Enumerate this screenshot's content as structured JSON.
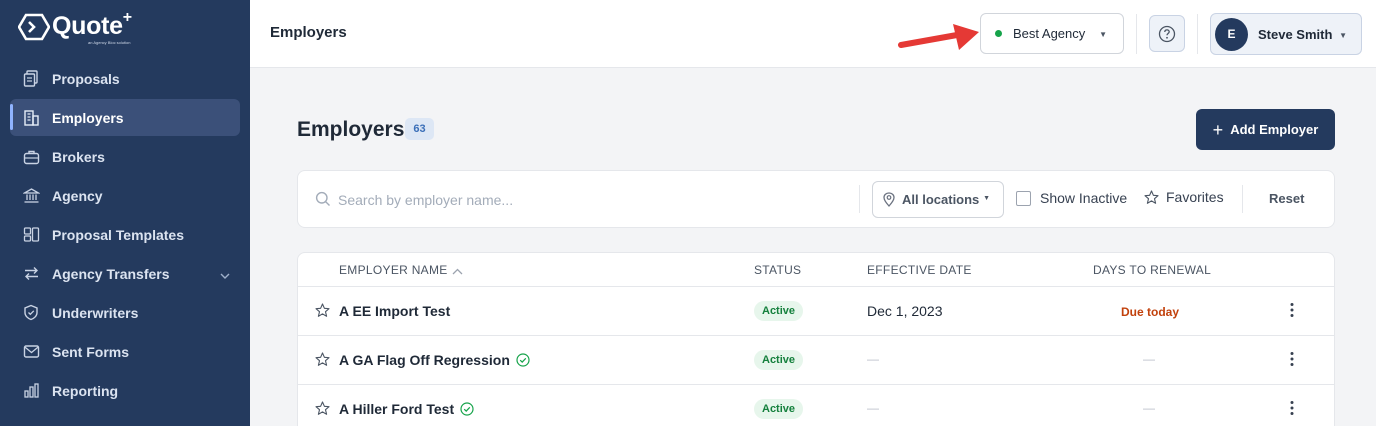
{
  "app": {
    "brand": "Quote",
    "brand_plus": "+",
    "brand_tagline": "an Agency Bloc solution"
  },
  "sidebar": {
    "items": [
      {
        "label": "Proposals",
        "icon": "document-icon"
      },
      {
        "label": "Employers",
        "icon": "building-icon",
        "active": true
      },
      {
        "label": "Brokers",
        "icon": "briefcase-icon"
      },
      {
        "label": "Agency",
        "icon": "bank-icon"
      },
      {
        "label": "Proposal Templates",
        "icon": "template-icon"
      },
      {
        "label": "Agency Transfers",
        "icon": "transfer-icon",
        "expandable": true
      },
      {
        "label": "Underwriters",
        "icon": "shield-icon"
      },
      {
        "label": "Sent Forms",
        "icon": "mail-icon"
      },
      {
        "label": "Reporting",
        "icon": "bar-chart-icon"
      }
    ]
  },
  "header": {
    "title": "Employers",
    "agency": {
      "label": "Best Agency",
      "status_color": "#16a34a"
    },
    "user": {
      "initial": "E",
      "name": "Steve Smith"
    }
  },
  "main": {
    "title": "Employers",
    "count": "63",
    "add_button_label": "Add Employer",
    "filters": {
      "search_placeholder": "Search by employer name...",
      "location_label": "All locations",
      "show_inactive_label": "Show Inactive",
      "favorites_label": "Favorites",
      "reset_label": "Reset"
    },
    "table": {
      "columns": [
        "EMPLOYER NAME",
        "STATUS",
        "EFFECTIVE DATE",
        "DAYS TO RENEWAL"
      ],
      "rows": [
        {
          "name": "A EE Import Test",
          "verified": false,
          "status": "Active",
          "effective_date": "Dec 1, 2023",
          "renewal": "Due today"
        },
        {
          "name": "A GA Flag Off Regression",
          "verified": true,
          "status": "Active",
          "effective_date": "—",
          "renewal": "—"
        },
        {
          "name": "A Hiller Ford Test",
          "verified": true,
          "status": "Active",
          "effective_date": "—",
          "renewal": "—"
        }
      ]
    }
  },
  "colors": {
    "sidebar": "#243a5e",
    "accent": "#243a5e",
    "active_status": "#15803d",
    "due": "#c2410c",
    "annotation_arrow": "#e53935"
  }
}
